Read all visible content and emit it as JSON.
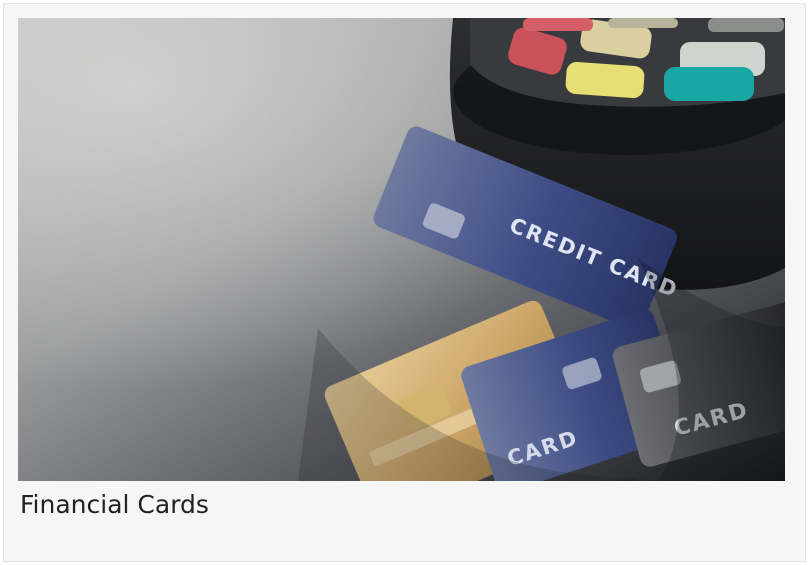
{
  "card": {
    "caption": "Financial Cards"
  },
  "image": {
    "card_text_top": "CREDIT CARD",
    "card_text_middle": "CARD",
    "card_text_right": "CARD"
  }
}
